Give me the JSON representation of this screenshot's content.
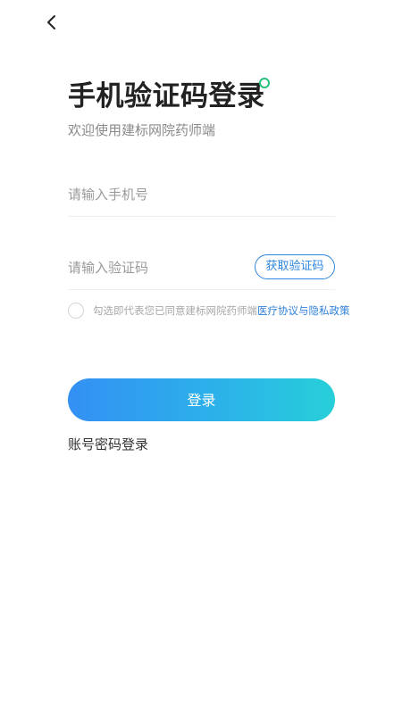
{
  "header": {
    "back_icon": "chevron-left-icon"
  },
  "title": "手机验证码登录",
  "subtitle": "欢迎使用建标网院药师端",
  "phone_field": {
    "value": "",
    "placeholder": "请输入手机号"
  },
  "code_field": {
    "value": "",
    "placeholder": "请输入验证码",
    "get_code_label": "获取验证码"
  },
  "agreement": {
    "checked": false,
    "prefix": "勾选即代表您已同意建标网院药师端",
    "link": "医疗协议与隐私政策"
  },
  "login_button": "登录",
  "password_login_link": "账号密码登录",
  "colors": {
    "accent_blue": "#2f86e0",
    "gradient_start": "#3390f4",
    "gradient_end": "#27cfd9",
    "title_dot": "#27c07a"
  }
}
